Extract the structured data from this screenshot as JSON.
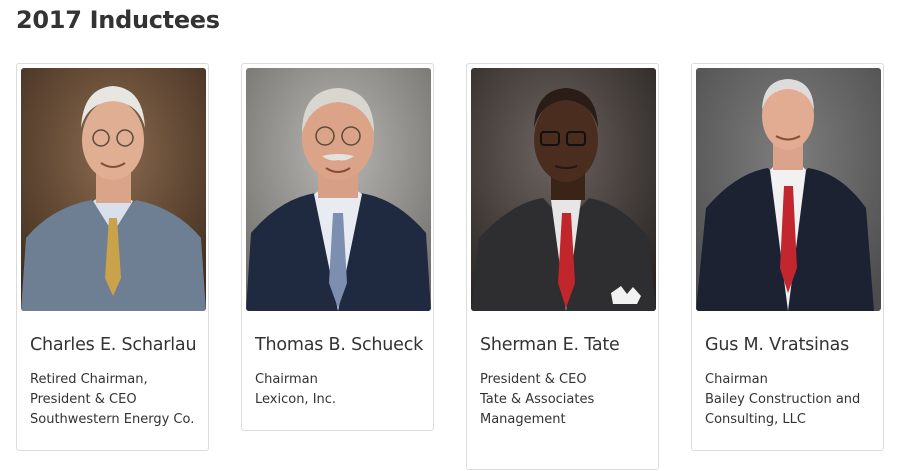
{
  "page": {
    "title": "2017 Inductees"
  },
  "inductees": [
    {
      "name": "Charles E. Scharlau",
      "lines": [
        "Retired Chairman,",
        "President & CEO",
        "Southwestern Energy Co."
      ],
      "photo": "portrait-photo"
    },
    {
      "name": "Thomas B. Schueck",
      "lines": [
        "Chairman",
        "Lexicon, Inc."
      ],
      "photo": "portrait-photo"
    },
    {
      "name": "Sherman E. Tate",
      "lines": [
        "President & CEO",
        "Tate & Associates",
        "Management"
      ],
      "photo": "portrait-photo"
    },
    {
      "name": "Gus M. Vratsinas",
      "lines": [
        "Chairman",
        "Bailey Construction and",
        "Consulting, LLC"
      ],
      "photo": "portrait-photo"
    }
  ]
}
